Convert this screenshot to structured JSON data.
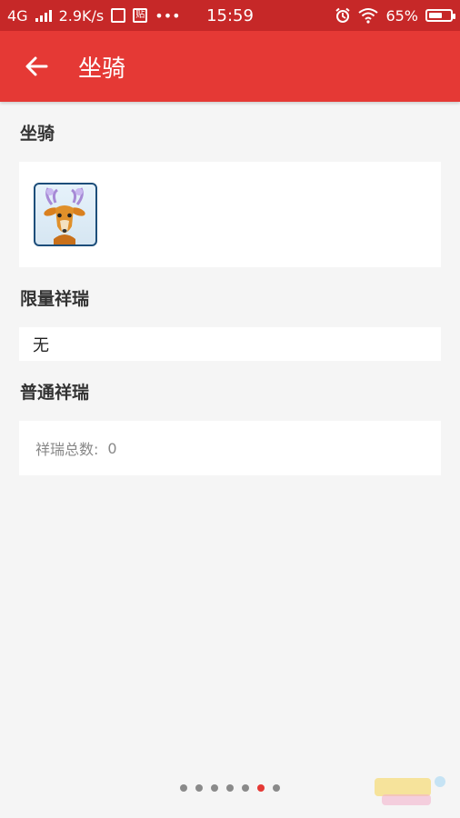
{
  "status_bar": {
    "network": "4G",
    "speed": "2.9K/s",
    "notif_badge_1": "",
    "notif_badge_2": "贴",
    "more_dots": "•••",
    "time": "15:59",
    "battery_percent": "65%",
    "battery_level": 0.65
  },
  "app_bar": {
    "title": "坐骑"
  },
  "sections": {
    "mount": {
      "title": "坐骑"
    },
    "limited": {
      "title": "限量祥瑞",
      "value": "无"
    },
    "normal": {
      "title": "普通祥瑞",
      "label": "祥瑞总数:",
      "value": "0"
    }
  },
  "pager": {
    "count": 7,
    "active_index": 5
  },
  "colors": {
    "status_bar": "#c62828",
    "app_bar": "#e53935",
    "background": "#f5f5f5",
    "accent": "#e53935"
  },
  "icons": {
    "back": "arrow-left-icon",
    "wifi": "wifi-icon",
    "alarm": "alarm-clock-icon",
    "mount": "deer-mount-icon"
  }
}
